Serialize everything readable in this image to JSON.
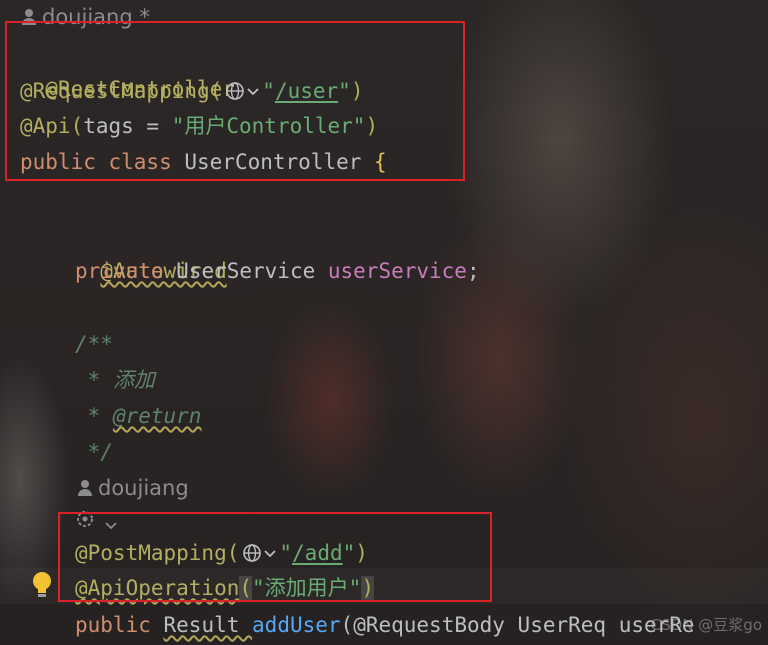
{
  "author_top": "doujiang *",
  "lines": {
    "l1": "@RestController",
    "l2_ann": "@RequestMapping(",
    "l2_str_open": "\"",
    "l2_path": "/user",
    "l2_str_close": "\"",
    "l2_close": ")",
    "l3_ann": "@Api(",
    "l3_attr": "tags = ",
    "l3_str": "\"用户Controller\"",
    "l3_close": ")",
    "l4_kw": "public class ",
    "l4_name": "UserController ",
    "l4_brace": "{",
    "l5": "@Autowired",
    "l6_kw": "private ",
    "l6_type": "UserService ",
    "l6_field": "userService",
    "l6_semi": ";",
    "l7": "/**",
    "l8_star": " * ",
    "l8_text": "添加",
    "l9_star": " * ",
    "l9_tag": "@return",
    "l10": " */",
    "author_mid": "doujiang",
    "l11_ann": "@PostMapping(",
    "l11_str_open": "\"",
    "l11_path": "/add",
    "l11_str_close": "\"",
    "l11_close": ")",
    "l12_ann": "@ApiOperation",
    "l12_paren_open": "(",
    "l12_str": "\"添加用户\"",
    "l12_paren_close": ")",
    "l13_kw": "public ",
    "l13_type": "Result ",
    "l13_fn": "addUser",
    "l13_rest": "(@RequestBody UserReq userRe"
  },
  "watermark": "CSDN @豆浆go",
  "colors": {
    "annotation": "#b3ae60",
    "keyword": "#cf8e6d",
    "string": "#6aab73",
    "field": "#c77dbb",
    "method": "#56a8f5",
    "doc": "#5f826b",
    "highlight_box": "#d9232b"
  }
}
